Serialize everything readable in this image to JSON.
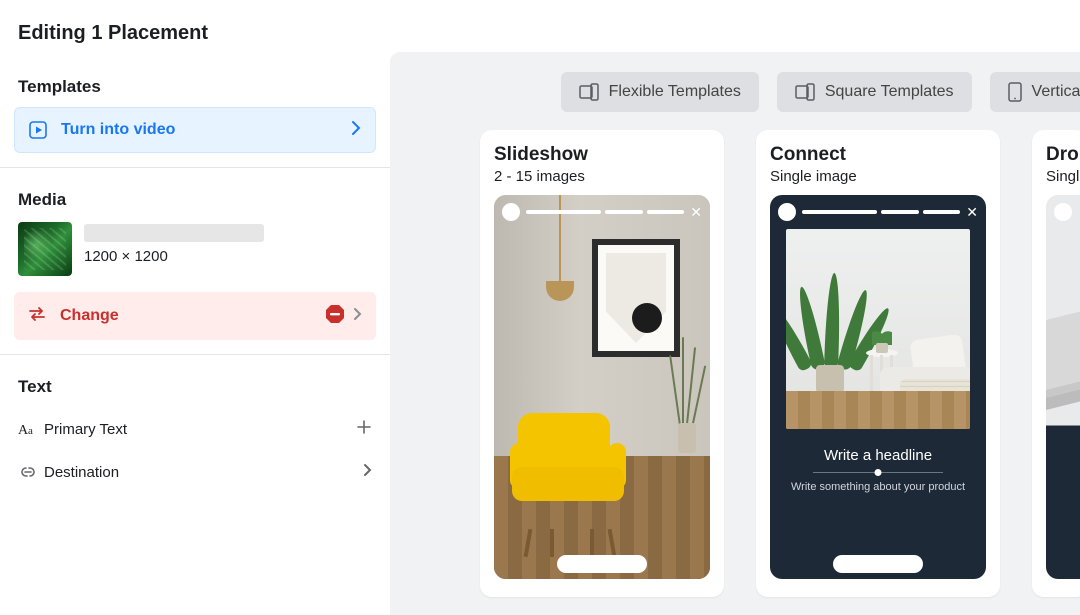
{
  "header": {
    "title": "Editing 1 Placement"
  },
  "sections": {
    "templates": {
      "heading": "Templates",
      "turn_into_video": "Turn into video"
    },
    "media": {
      "heading": "Media",
      "dimensions": "1200 × 1200",
      "change_label": "Change"
    },
    "text": {
      "heading": "Text",
      "primary_text": "Primary Text",
      "destination": "Destination"
    }
  },
  "tabs": {
    "flexible": "Flexible Templates",
    "square": "Square Templates",
    "vertical": "Vertical "
  },
  "cards": {
    "slideshow": {
      "title": "Slideshow",
      "subtitle": "2 - 15 images"
    },
    "connect": {
      "title": "Connect",
      "subtitle": "Single image",
      "headline": "Write a headline",
      "body": "Write something about your product"
    },
    "drop": {
      "title": "Drop",
      "subtitle": "Singl"
    }
  }
}
